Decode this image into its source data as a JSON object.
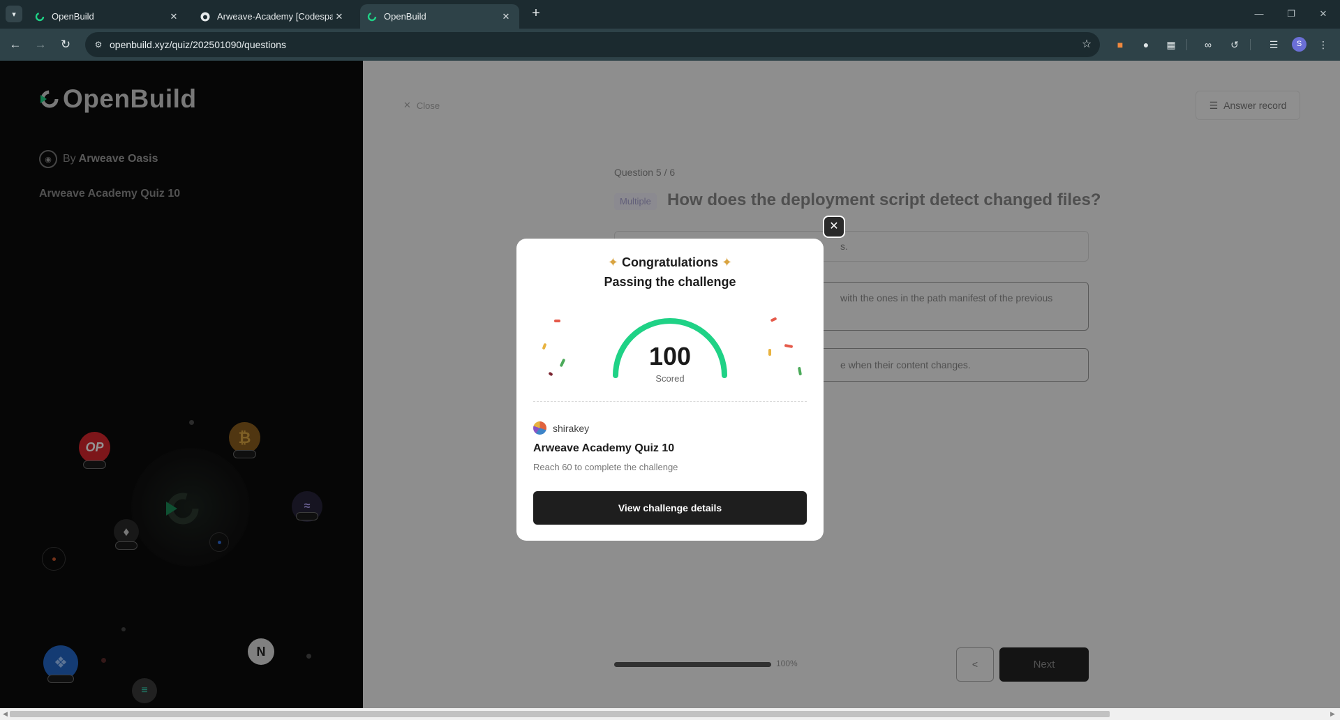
{
  "browser": {
    "tabs": [
      {
        "title": "OpenBuild",
        "active": false
      },
      {
        "title": "Arweave-Academy [Codespaces",
        "active": false
      },
      {
        "title": "OpenBuild",
        "active": true
      }
    ],
    "url": "openbuild.xyz/quiz/202501090/questions",
    "profile_initial": "S"
  },
  "sidebar": {
    "brand": "OpenBuild",
    "by_prefix": "By",
    "by_name": "Arweave Oasis",
    "quiz_name": "Arweave Academy Quiz 10"
  },
  "quiz": {
    "close_label": "Close",
    "answer_record_label": "Answer record",
    "counter": "Question 5 / 6",
    "type": "Multiple",
    "question": "How does the deployment script detect changed files?",
    "options": [
      {
        "visible_text": "s."
      },
      {
        "visible_text": "with the ones in the path manifest of the previous"
      },
      {
        "visible_text": "e when their content changes."
      }
    ],
    "progress_percent": 100,
    "progress_label": "100%",
    "prev_label": "<",
    "next_label": "Next"
  },
  "modal": {
    "title": "Congratulations",
    "subtitle": "Passing the challenge",
    "score": "100",
    "score_label": "Scored",
    "user": "shirakey",
    "quiz_name": "Arweave Academy Quiz 10",
    "requirement": "Reach 60 to complete the challenge",
    "button_label": "View challenge details",
    "accent": "#1fd286"
  }
}
